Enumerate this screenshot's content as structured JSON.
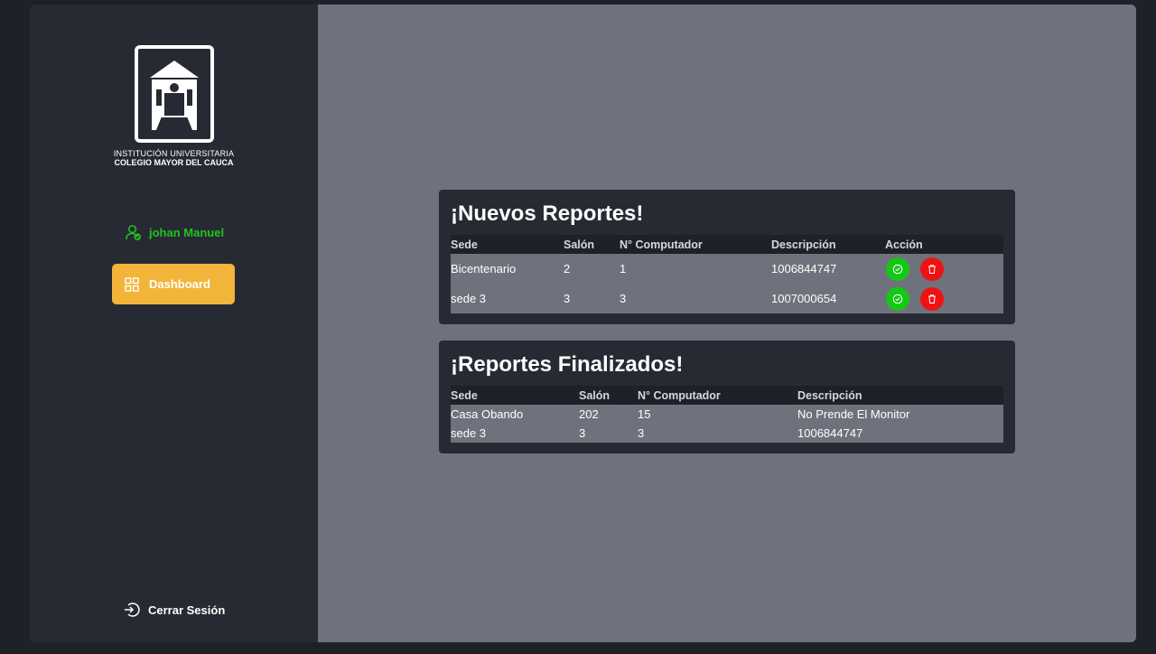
{
  "sidebar": {
    "logo": {
      "line1": "INSTITUCIÓN UNIVERSITARIA",
      "line2": "COLEGIO MAYOR DEL CAUCA"
    },
    "user": {
      "name": "johan Manuel",
      "icon": "user-check-icon"
    },
    "nav": [
      {
        "label": "Dashboard",
        "icon": "dashboard-grid-icon"
      }
    ],
    "logout": {
      "label": "Cerrar Sesión",
      "icon": "logout-icon"
    }
  },
  "new_reports": {
    "title": "¡Nuevos Reportes!",
    "columns": [
      "Sede",
      "Salón",
      "N° Computador",
      "Descripción",
      "Acción"
    ],
    "rows": [
      {
        "sede": "Bicentenario",
        "salon": "2",
        "computador": "1",
        "descripcion": "1006844747"
      },
      {
        "sede": "sede 3",
        "salon": "3",
        "computador": "3",
        "descripcion": "1007000654"
      }
    ],
    "actions": {
      "approve_icon": "check-circle-icon",
      "delete_icon": "trash-icon"
    }
  },
  "finished_reports": {
    "title": "¡Reportes Finalizados!",
    "columns": [
      "Sede",
      "Salón",
      "N° Computador",
      "Descripción"
    ],
    "rows": [
      {
        "sede": "Casa Obando",
        "salon": "202",
        "computador": "15",
        "descripcion": "No Prende El Monitor"
      },
      {
        "sede": "sede 3",
        "salon": "3",
        "computador": "3",
        "descripcion": "1006844747"
      }
    ]
  },
  "colors": {
    "sidebar_bg": "#272a33",
    "main_bg": "#6f727c",
    "accent": "#f2b53a",
    "user_green": "#1fc41f",
    "approve": "#14c814",
    "delete": "#f01212"
  }
}
